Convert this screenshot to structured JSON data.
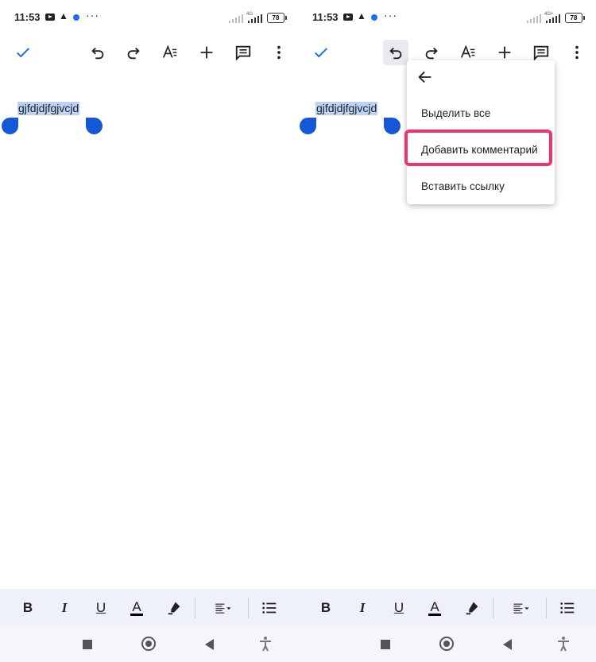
{
  "left": {
    "status": {
      "time": "11:53",
      "network": "4G",
      "battery": "78"
    },
    "document": {
      "selected_text": "gjfdjdjfgjvcjd"
    }
  },
  "right": {
    "status": {
      "time": "11:53",
      "network": "4G+",
      "battery": "78"
    },
    "document": {
      "selected_text": "gjfdjdjfgjvcjd"
    },
    "menu": {
      "items": [
        {
          "label": "Выделить все"
        },
        {
          "label": "Добавить комментарий",
          "highlighted": true
        },
        {
          "label": "Вставить ссылку"
        }
      ]
    }
  },
  "colors": {
    "accent": "#1a73e8",
    "selection": "#bcd3f5",
    "handle": "#1558d6",
    "highlight_border": "#f0336f",
    "format_bar": "#eef1f8"
  },
  "icons": {
    "toolbar": [
      "check-icon",
      "undo-icon",
      "redo-icon",
      "text-format-icon",
      "insert-plus-icon",
      "comment-icon",
      "more-vert-icon"
    ],
    "format": [
      "bold-icon",
      "italic-icon",
      "underline-icon",
      "text-color-icon",
      "highlighter-icon",
      "align-icon",
      "list-icon"
    ],
    "nav": [
      "recents-square-icon",
      "home-circle-icon",
      "back-triangle-icon",
      "accessibility-icon"
    ]
  }
}
